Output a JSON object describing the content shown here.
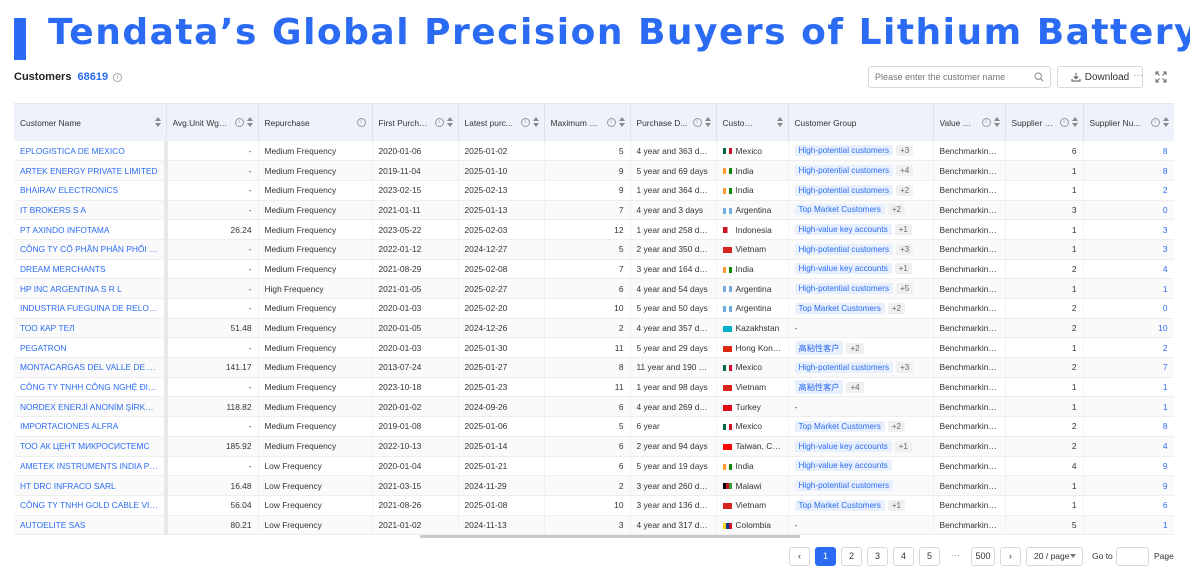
{
  "banner": {
    "title": "Tendata’s Global Precision Buyers of Lithium Battery"
  },
  "toolbar": {
    "customers_label": "Customers",
    "customers_count": "68619",
    "search_placeholder": "Please enter the customer name",
    "download_label": "Download",
    "more_label": "···"
  },
  "table": {
    "columns": [
      "Customer Name",
      "Avg.Unit Wgt ...",
      "Repurchase",
      "First Purcha...",
      "Latest purc...",
      "Maximum D...",
      "Purchase D...",
      "Customer L...",
      "Customer Group",
      "Value Strat...",
      "Supplier L...",
      "Supplier Nu..."
    ],
    "rows": [
      [
        "EPLOGISTICA DE MEXICO",
        "-",
        "Medium Frequency",
        "2020-01-06",
        "2025-01-02",
        "5",
        "4 year and 363 days",
        "Mexico",
        "High-potential customers",
        "+3",
        "Benchmarking ...",
        "6",
        "8"
      ],
      [
        "ARTEK ENERGY PRIVATE LIMITED",
        "-",
        "Medium Frequency",
        "2019-11-04",
        "2025-01-10",
        "9",
        "5 year and 69 days",
        "India",
        "High-potential customers",
        "+4",
        "Benchmarking ...",
        "1",
        "8"
      ],
      [
        "BHAIRAV ELECTRONICS",
        "-",
        "Medium Frequency",
        "2023-02-15",
        "2025-02-13",
        "9",
        "1 year and 364 days",
        "India",
        "High-potential customers",
        "+2",
        "Benchmarking ...",
        "1",
        "2"
      ],
      [
        "IT BROKERS S A",
        "-",
        "Medium Frequency",
        "2021-01-11",
        "2025-01-13",
        "7",
        "4 year and 3 days",
        "Argentina",
        "Top Market Customers",
        "+2",
        "Benchmarking ...",
        "3",
        "0"
      ],
      [
        "PT AXINDO INFOTAMA",
        "26.24",
        "Medium Frequency",
        "2023-05-22",
        "2025-02-03",
        "12",
        "1 year and 258 days",
        "Indonesia",
        "High-value key accounts",
        "+1",
        "Benchmarking ...",
        "1",
        "3"
      ],
      [
        "CÔNG TY CỔ PHẦN PHÂN PHỐI CÔNG...",
        "-",
        "Medium Frequency",
        "2022-01-12",
        "2024-12-27",
        "5",
        "2 year and 350 days",
        "Vietnam",
        "High-potential customers",
        "+3",
        "Benchmarking ...",
        "1",
        "3"
      ],
      [
        "DREAM MERCHANTS",
        "-",
        "Medium Frequency",
        "2021-08-29",
        "2025-02-08",
        "7",
        "3 year and 164 days",
        "India",
        "High-value key accounts",
        "+1",
        "Benchmarking ...",
        "2",
        "4"
      ],
      [
        "HP INC ARGENTINA S R L",
        "-",
        "High Frequency",
        "2021-01-05",
        "2025-02-27",
        "6",
        "4 year and 54 days",
        "Argentina",
        "High-potential customers",
        "+5",
        "Benchmarking ...",
        "1",
        "1"
      ],
      [
        "INDUSTRIA FUEGUINA DE RELOJERIA...",
        "-",
        "Medium Frequency",
        "2020-01-03",
        "2025-02-20",
        "10",
        "5 year and 50 days",
        "Argentina",
        "Top Market Customers",
        "+2",
        "Benchmarking ...",
        "2",
        "0"
      ],
      [
        "ТОО КАР ТЕЛ",
        "51.48",
        "Medium Frequency",
        "2020-01-05",
        "2024-12-26",
        "2",
        "4 year and 357 days",
        "Kazakhstan",
        "-",
        "",
        "Benchmarking ...",
        "2",
        "10"
      ],
      [
        "PEGATRON",
        "-",
        "Medium Frequency",
        "2020-01-03",
        "2025-01-30",
        "11",
        "5 year and 29 days",
        "Hong Kong,...",
        "高粘性客户",
        "+2",
        "Benchmarking ...",
        "1",
        "2"
      ],
      [
        "MONTACARGAS DEL VALLE DE MEXICO",
        "141.17",
        "Medium Frequency",
        "2013-07-24",
        "2025-01-27",
        "8",
        "11 year and 190 days",
        "Mexico",
        "High-potential customers",
        "+3",
        "Benchmarking ...",
        "2",
        "7"
      ],
      [
        "CÔNG TY TNHH CÔNG NGHỆ ĐIỆN LO...",
        "-",
        "Medium Frequency",
        "2023-10-18",
        "2025-01-23",
        "11",
        "1 year and 98 days",
        "Vietnam",
        "高粘性客户",
        "+4",
        "Benchmarking ...",
        "1",
        "1"
      ],
      [
        "NORDEX ENERJİ ANONİM ŞİRKETİ",
        "118.82",
        "Medium Frequency",
        "2020-01-02",
        "2024-09-26",
        "6",
        "4 year and 269 days",
        "Turkey",
        "-",
        "",
        "Benchmarking ...",
        "1",
        "1"
      ],
      [
        "IMPORTACIONES ALFRA",
        "-",
        "Medium Frequency",
        "2019-01-08",
        "2025-01-06",
        "5",
        "6 year",
        "Mexico",
        "Top Market Customers",
        "+2",
        "Benchmarking ...",
        "2",
        "8"
      ],
      [
        "ТОО АК ЦЕНТ МИКРОСИСТЕМС",
        "185.92",
        "Medium Frequency",
        "2022-10-13",
        "2025-01-14",
        "6",
        "2 year and 94 days",
        "Taiwan, China",
        "High-value key accounts",
        "+1",
        "Benchmarking ...",
        "2",
        "4"
      ],
      [
        "AMETEK INSTRUMENTS INDIA PVT LTD",
        "-",
        "Low Frequency",
        "2020-01-04",
        "2025-01-21",
        "6",
        "5 year and 19 days",
        "India",
        "High-value key accounts",
        "",
        "Benchmarking ...",
        "4",
        "9"
      ],
      [
        "HT DRC INFRACO SARL",
        "16.48",
        "Low Frequency",
        "2021-03-15",
        "2024-11-29",
        "2",
        "3 year and 260 days",
        "Malawi",
        "High-potential customers",
        "",
        "Benchmarking ...",
        "1",
        "9"
      ],
      [
        "CÔNG TY TNHH GOLD CABLE VIỆT NA...",
        "56.04",
        "Low Frequency",
        "2021-08-26",
        "2025-01-08",
        "10",
        "3 year and 136 days",
        "Vietnam",
        "Top Market Customers",
        "+1",
        "Benchmarking ...",
        "1",
        "6"
      ],
      [
        "AUTOELITE SAS",
        "80.21",
        "Low Frequency",
        "2021-01-02",
        "2024-11-13",
        "3",
        "4 year and 317 days",
        "Colombia",
        "-",
        "",
        "Benchmarking ...",
        "5",
        "1"
      ]
    ]
  },
  "flags": {
    "Mexico": [
      "#006847",
      "#ffffff",
      "#ce1126"
    ],
    "India": [
      "#ff9933",
      "#ffffff",
      "#138808"
    ],
    "Argentina": [
      "#74acdf",
      "#ffffff",
      "#74acdf"
    ],
    "Indonesia": [
      "#ce1126",
      "#ffffff"
    ],
    "Vietnam": [
      "#da251d"
    ],
    "Kazakhstan": [
      "#00afca"
    ],
    "Hong Kong,...": [
      "#de2910"
    ],
    "Turkey": [
      "#e30a17"
    ],
    "Taiwan, China": [
      "#fe0000"
    ],
    "Malawi": [
      "#000000",
      "#ce1126",
      "#339e35"
    ],
    "Colombia": [
      "#fcd116",
      "#003893",
      "#ce1126"
    ]
  },
  "pagination": {
    "pages": [
      "1",
      "2",
      "3",
      "4",
      "5"
    ],
    "ellipsis": "···",
    "last_page": "500",
    "page_size": "20 / page",
    "goto_label": "Go to",
    "page_label": "Page",
    "prev_label": "‹",
    "next_label": "›"
  },
  "colors": {
    "accent": "#2b6bf3"
  }
}
